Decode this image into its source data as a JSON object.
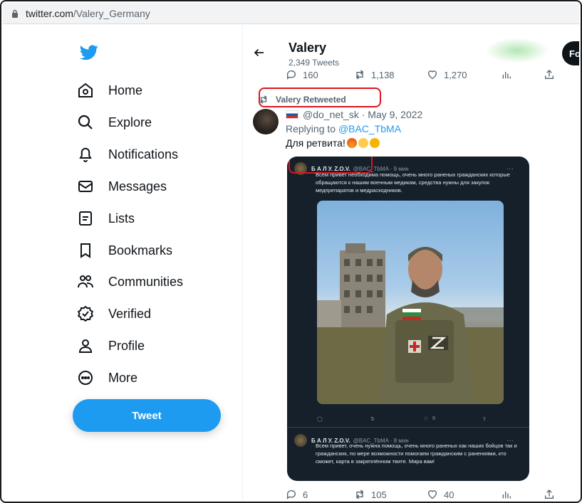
{
  "browser": {
    "url_host": "twitter.com",
    "url_path": "/Valery_Germany"
  },
  "sidebar": {
    "items": [
      {
        "label": "Home",
        "icon": "home-icon"
      },
      {
        "label": "Explore",
        "icon": "search-icon"
      },
      {
        "label": "Notifications",
        "icon": "bell-icon"
      },
      {
        "label": "Messages",
        "icon": "mail-icon"
      },
      {
        "label": "Lists",
        "icon": "list-icon"
      },
      {
        "label": "Bookmarks",
        "icon": "bookmark-icon"
      },
      {
        "label": "Communities",
        "icon": "communities-icon"
      },
      {
        "label": "Verified",
        "icon": "verified-icon"
      },
      {
        "label": "Profile",
        "icon": "person-icon"
      },
      {
        "label": "More",
        "icon": "more-icon"
      }
    ],
    "tweet_button": "Tweet"
  },
  "header": {
    "name": "Valery",
    "tweet_count": "2,349 Tweets",
    "follow_label": "Fo"
  },
  "top_actions": {
    "replies": "160",
    "retweets": "1,138",
    "likes": "1,270"
  },
  "retweet": {
    "label": "Valery Retweeted",
    "author_handle": "@do_net_sk",
    "date": "May 9, 2022",
    "replying_prefix": "Replying to",
    "replying_to": "@BAC_TbMA",
    "text": "Для ретвита!"
  },
  "embedded": {
    "first": {
      "name": "Б А Л У. Z.O.V.",
      "handle": "@BAC_TbMA · 9 мин",
      "text": "Всем привет необходима помощь, очень много раненых гражданских которые обращаются к нашим военным медикам, средства нужны для закупок медпрепаратов и медрасходников."
    },
    "actions": {
      "retweets": "",
      "likes": "9"
    },
    "second": {
      "name": "Б А Л У. Z.O.V.",
      "handle": "@BAC_TbMA · 8 мин",
      "text": "Всем привет, очень нужна помощь, очень много раненых как наших бойцов так и гражданских, по мере возможности помогаем гражданским с ранениями, кто сможет, карта в закреплённом твите. Мира вам!"
    }
  },
  "bottom_actions": {
    "replies": "6",
    "retweets": "105",
    "likes": "40"
  }
}
